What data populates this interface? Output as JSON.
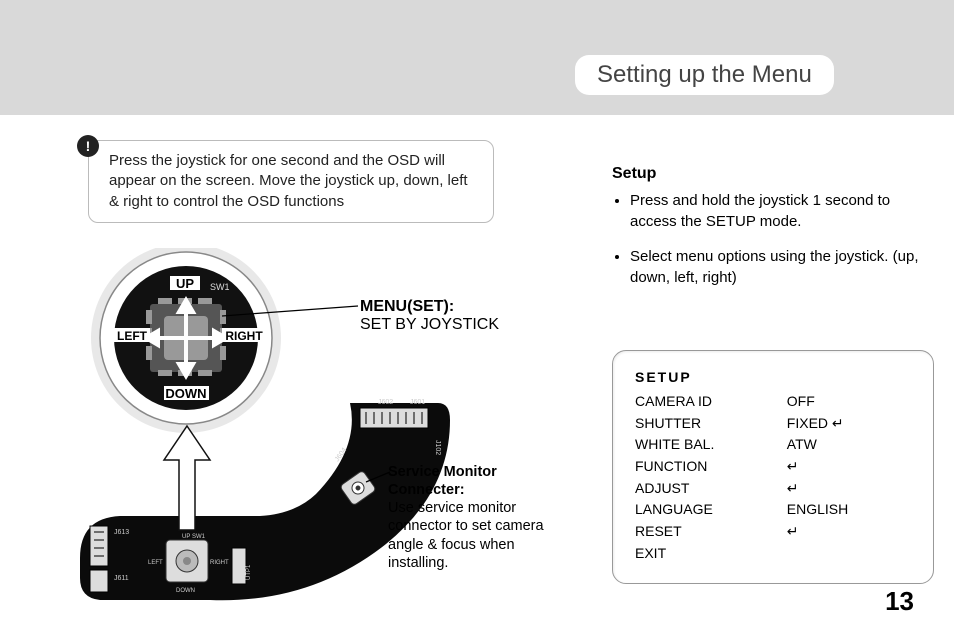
{
  "header": {
    "title": "Setting up the Menu"
  },
  "note": {
    "icon": "!",
    "text": "Press the joystick for one second and the OSD will appear on the screen. Move the joystick up, down, left & right to control the OSD functions"
  },
  "setup": {
    "heading": "Setup",
    "items": [
      "Press and hold the joystick 1 second to access the SETUP mode.",
      "Select menu options using the joystick. (up, down, left, right)"
    ]
  },
  "osd": {
    "title": "SETUP",
    "rows": [
      {
        "label": "CAMERA ID",
        "value": "OFF"
      },
      {
        "label": "SHUTTER",
        "value": "FIXED ↵"
      },
      {
        "label": "WHITE BAL.",
        "value": "ATW"
      },
      {
        "label": "FUNCTION",
        "value": "↵"
      },
      {
        "label": "ADJUST",
        "value": "↵"
      },
      {
        "label": "LANGUAGE",
        "value": "ENGLISH"
      },
      {
        "label": "RESET",
        "value": "↵"
      },
      {
        "label": "EXIT",
        "value": ""
      }
    ]
  },
  "diagram": {
    "joystick": {
      "up": "UP",
      "down": "DOWN",
      "left": "LEFT",
      "right": "RIGHT",
      "sw": "SW1"
    },
    "menu_label_title": "MENU(SET):",
    "menu_label_sub": "SET BY JOYSTICK",
    "svc_title": "Service Monitor Connecter:",
    "svc_text": "Use service monitor connector to set camera angle & focus when installing.",
    "board": {
      "j601": "J601",
      "j602": "J602",
      "j604": "J604",
      "j102": "J102",
      "j611": "J611",
      "j613": "J613",
      "utp1": "UTP1",
      "small_sw": "SW1",
      "small_up": "UP",
      "small_down": "DOWN",
      "small_left": "LEFT",
      "small_right": "RIGHT"
    }
  },
  "page": "13"
}
